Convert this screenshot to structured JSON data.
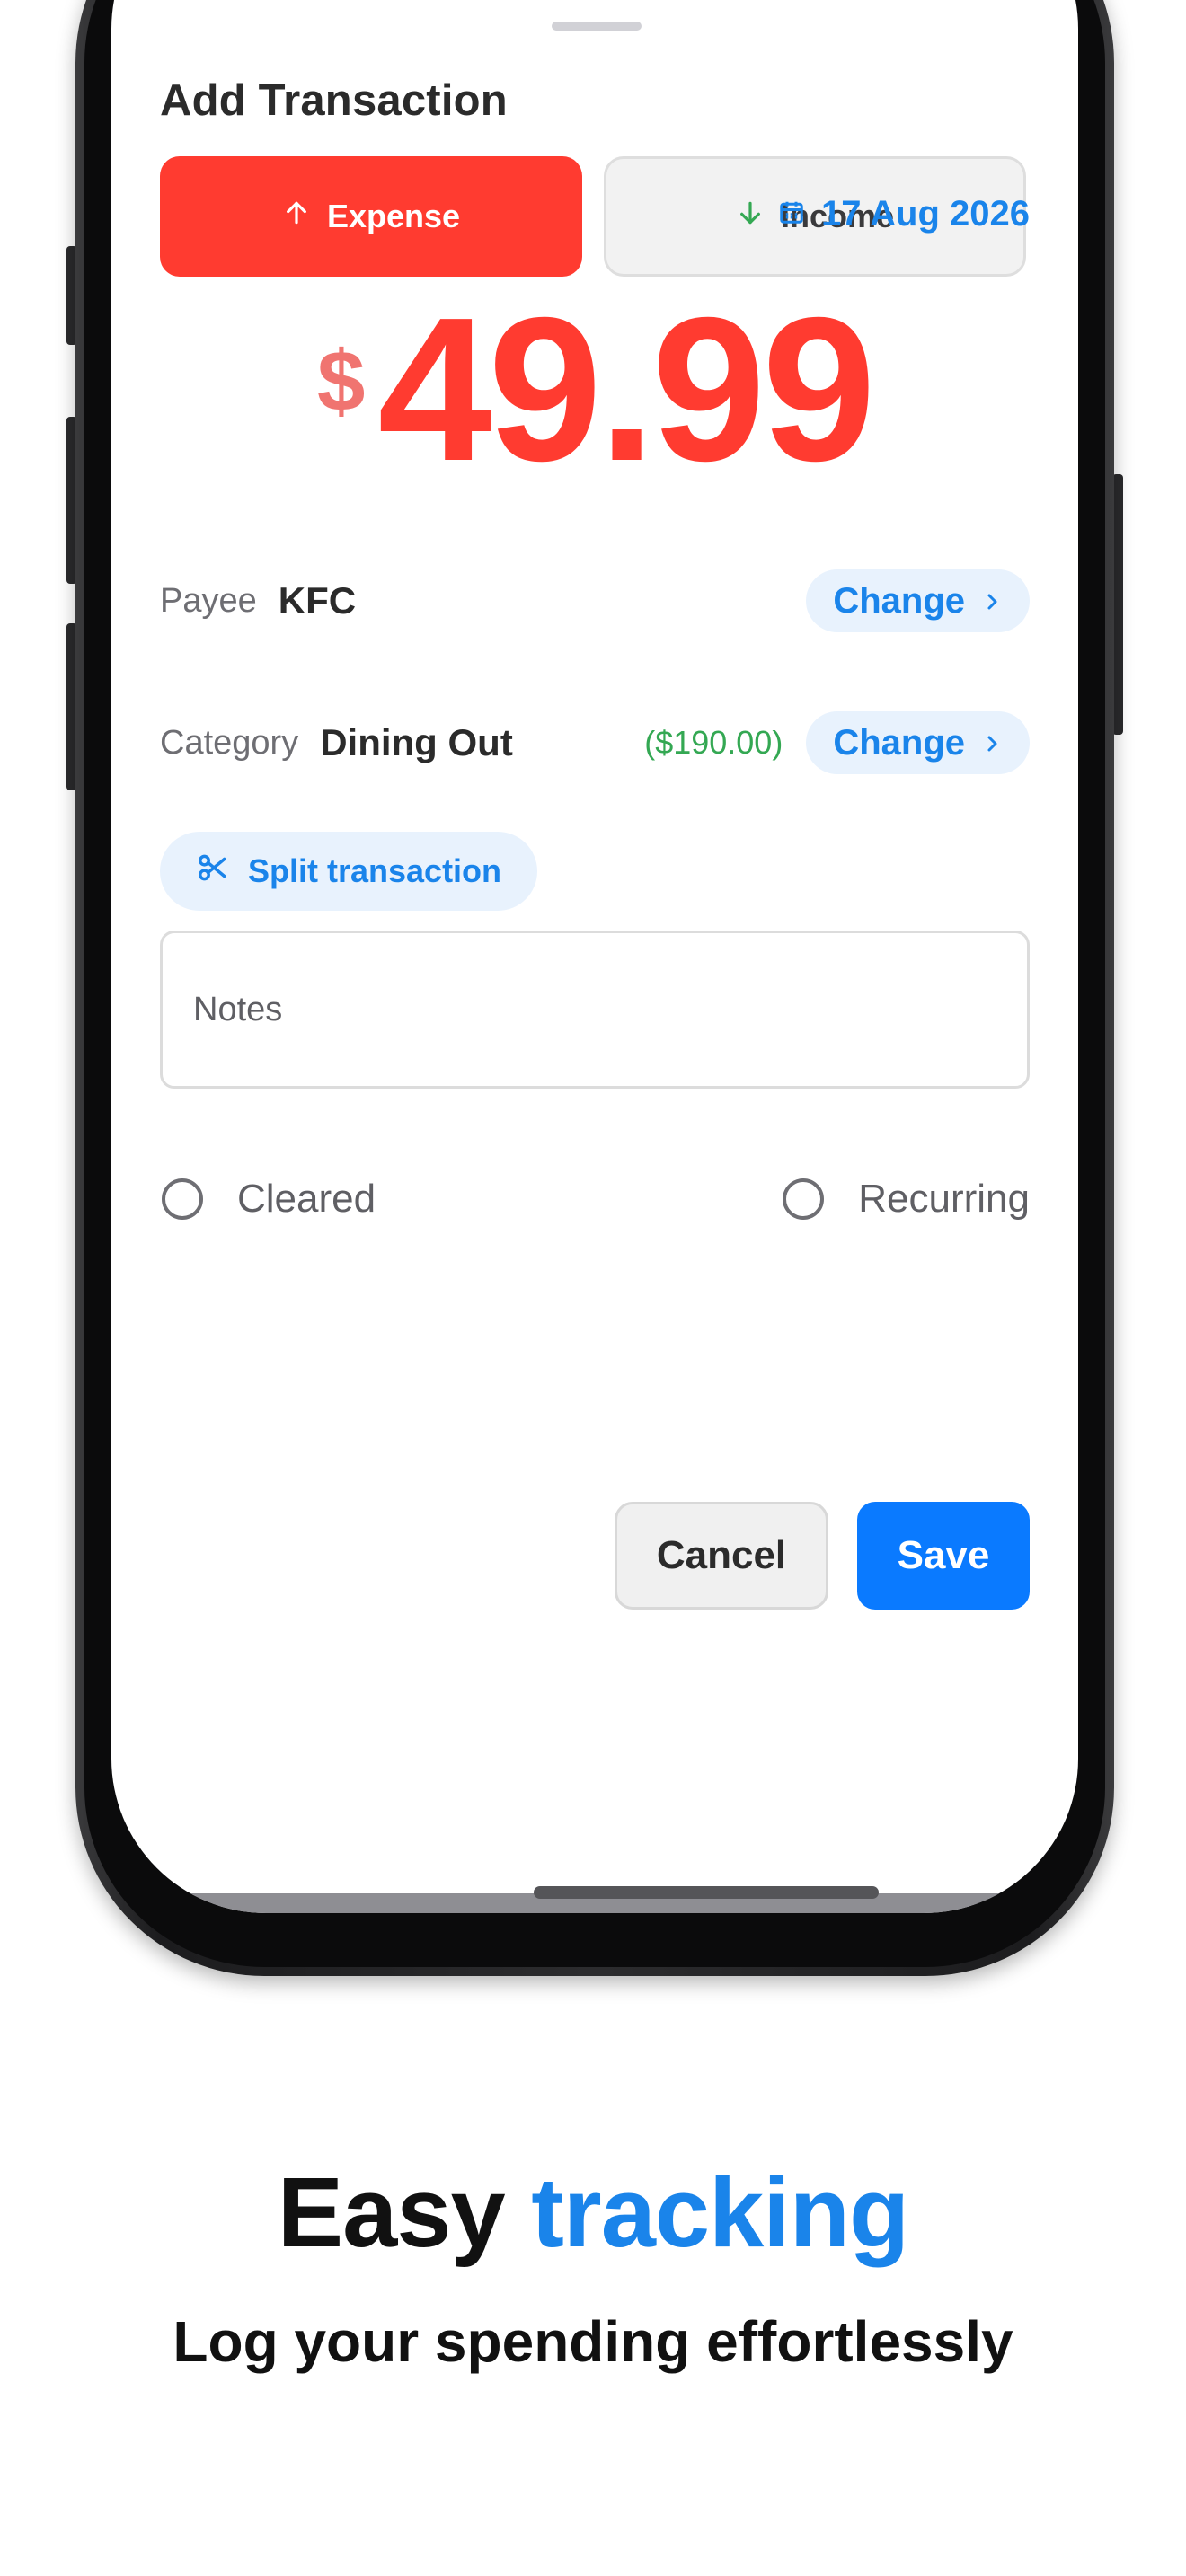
{
  "sheet": {
    "title": "Add Transaction",
    "type_options": {
      "expense_label": "Expense",
      "income_label": "Income",
      "selected": "Expense"
    },
    "date": "17 Aug 2026",
    "amount": {
      "currency_symbol": "$",
      "value": "49.99"
    },
    "payee": {
      "label": "Payee",
      "value": "KFC",
      "change_label": "Change"
    },
    "category": {
      "label": "Category",
      "value": "Dining Out",
      "balance": "($190.00)",
      "change_label": "Change"
    },
    "split_label": "Split transaction",
    "notes": {
      "placeholder": "Notes",
      "value": ""
    },
    "cleared": {
      "label": "Cleared",
      "checked": false
    },
    "recurring": {
      "label": "Recurring",
      "checked": false
    },
    "cancel_label": "Cancel",
    "save_label": "Save"
  },
  "caption": {
    "headline_part1": "Easy",
    "headline_part2": "tracking",
    "subheadline": "Log your spending effortlessly"
  },
  "colors": {
    "expense": "#ff3b30",
    "accent_blue": "#1a84ea",
    "save_button": "#0a7aff",
    "balance_green": "#34a853"
  },
  "icons": {
    "expense": "arrow-up-icon",
    "income": "arrow-down-icon",
    "date": "calendar-icon",
    "change": "chevron-right-icon",
    "split": "scissors-icon"
  }
}
